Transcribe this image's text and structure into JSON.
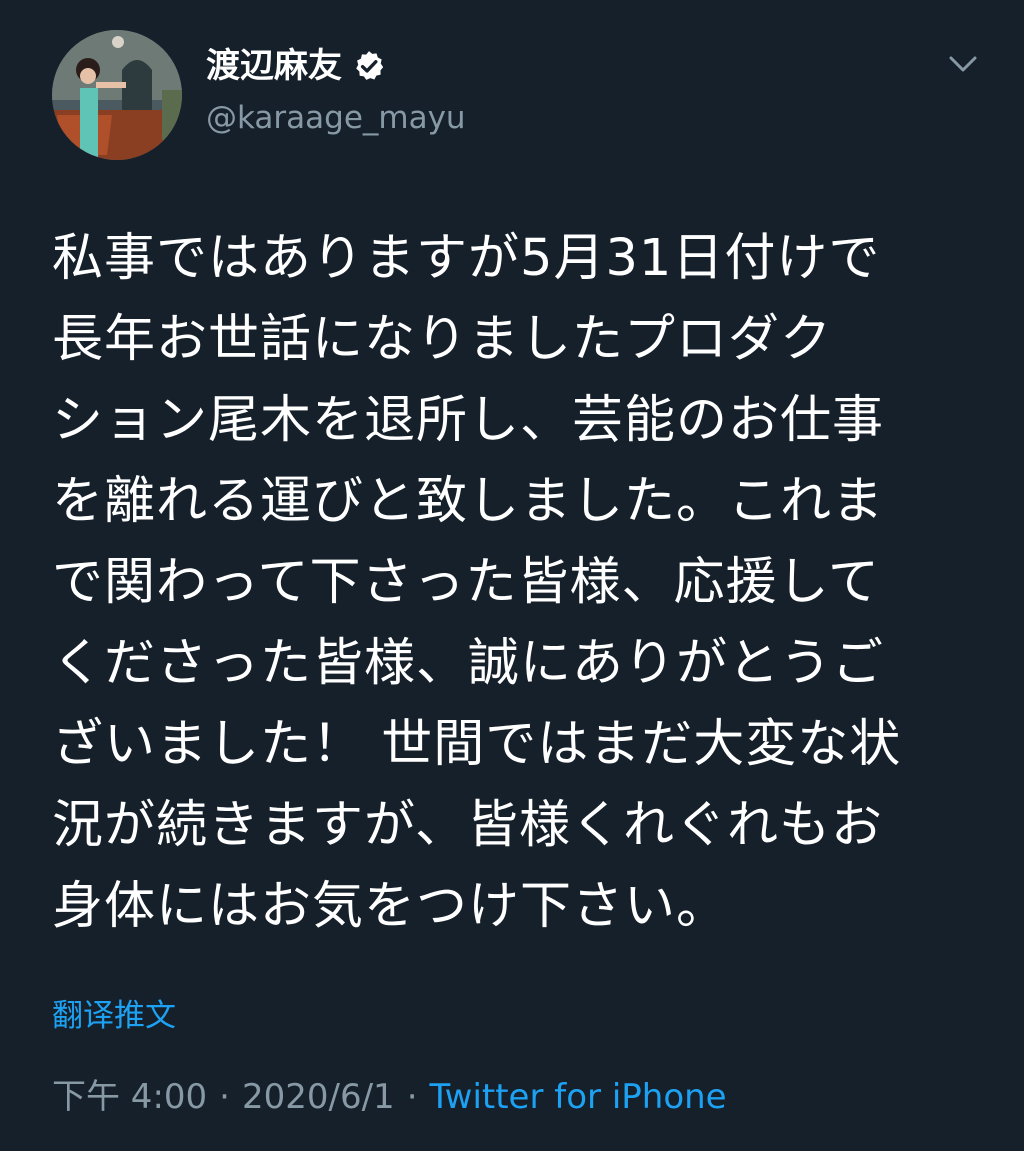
{
  "user": {
    "display_name": "渡辺麻友",
    "handle": "@karaage_mayu",
    "verified": true,
    "avatar_icon": "profile-photo"
  },
  "menu": {
    "icon": "chevron-down-icon"
  },
  "tweet": {
    "lines": [
      "私事ではありますが5月31日付けで",
      "長年お世話になりましたプロダク",
      "ション尾木を退所し、芸能のお仕事",
      "を離れる運びと致しました。これま",
      "で関わって下さった皆様、応援して",
      "くださった皆様、誠にありがとうご",
      "ざいました！ 世間ではまだ大変な状",
      "況が続きますが、皆様くれぐれもお",
      "身体にはお気をつけ下さい。"
    ],
    "translate_label": "翻译推文"
  },
  "meta": {
    "time": "下午 4:00",
    "separator": "·",
    "date": "2020/6/1",
    "source": "Twitter for iPhone"
  },
  "colors": {
    "background": "#15202b",
    "text": "#ffffff",
    "muted": "#8899a6",
    "accent": "#1da1f2"
  }
}
